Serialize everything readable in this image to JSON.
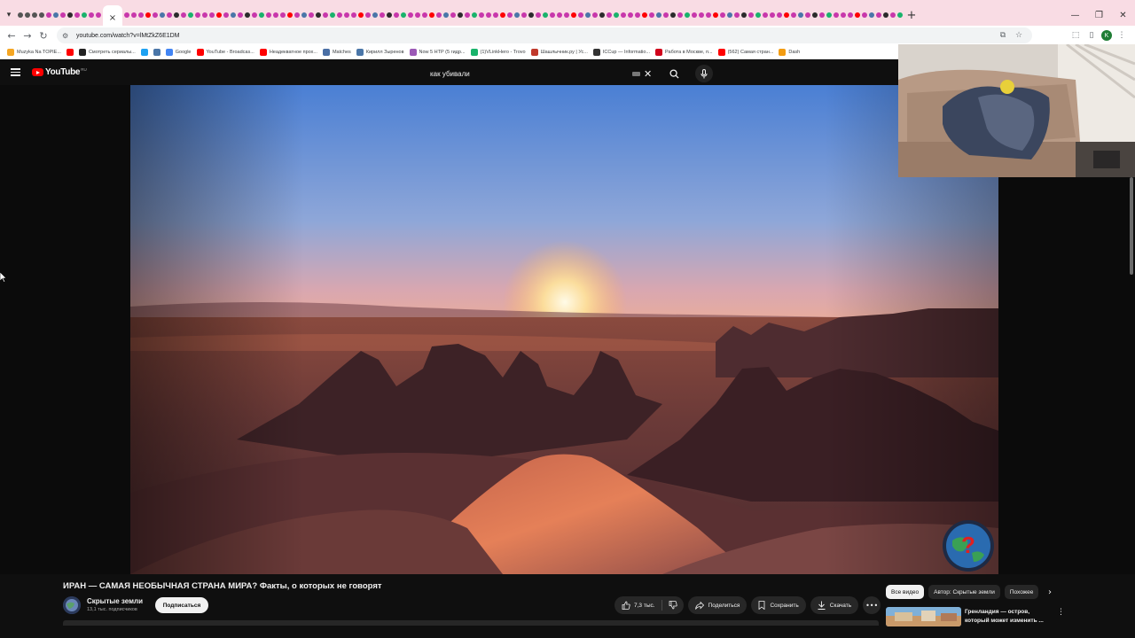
{
  "browser": {
    "url": "youtube.com/watch?v=lMtZkZ6E1DM",
    "active_tab_close": "×",
    "new_tab": "+",
    "bookmarks": [
      {
        "label": "Muzyka Na TOPIE...",
        "color": "#f5a623"
      },
      {
        "label": "",
        "color": "#ff0000"
      },
      {
        "label": "Смотреть сериалы...",
        "color": "#222222"
      },
      {
        "label": "",
        "color": "#1da1f2"
      },
      {
        "label": "",
        "color": "#4a76a8"
      },
      {
        "label": "Google",
        "color": "#4285f4"
      },
      {
        "label": "YouTube - Broadcas...",
        "color": "#ff0000"
      },
      {
        "label": "Неадекватное прох...",
        "color": "#ff0000"
      },
      {
        "label": "Matches",
        "color": "#4a6fa5"
      },
      {
        "label": "Кирилл Зыренов",
        "color": "#4a76a8"
      },
      {
        "label": "Now 5 НТР (5 гидр...",
        "color": "#9b59b6"
      },
      {
        "label": "(1)VLinkHero - Trovo",
        "color": "#19b36b"
      },
      {
        "label": "Шашлычник.ру | Ус...",
        "color": "#c0392b"
      },
      {
        "label": "ICCup — Informatio...",
        "color": "#333333"
      },
      {
        "label": "Работа в Москве, п...",
        "color": "#d0021b"
      },
      {
        "label": "(562) Самая стран...",
        "color": "#ff0000"
      },
      {
        "label": "Dash",
        "color": "#f39c12"
      }
    ]
  },
  "youtube": {
    "logo_text": "YouTube",
    "region": "RU",
    "search_value": "как убивали",
    "clear_icon": "✕"
  },
  "video": {
    "title": "ИРАН — САМАЯ НЕОБЫЧНАЯ СТРАНА МИРА? Факты, о которых не говорят",
    "channel_name": "Скрытые земли",
    "subscribers": "13,1 тыс. подписчиков",
    "subscribe_label": "Подписаться",
    "likes": "7,3 тыс.",
    "share_label": "Поделиться",
    "save_label": "Сохранить",
    "download_label": "Скачать",
    "more_label": "•••"
  },
  "recommendations": {
    "chips": [
      "Все видео",
      "Автор: Скрытые земли",
      "Похожее"
    ],
    "chip_next": "›",
    "first_title": "Гренландия — остров, который может изменить ...",
    "more_icon": "⋮"
  }
}
